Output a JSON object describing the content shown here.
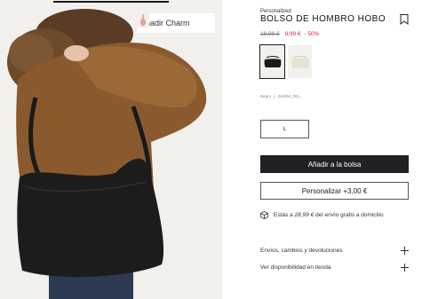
{
  "product": {
    "tag": "Personalized",
    "title": "BOLSO DE HOMBRO HOBO",
    "price_old": "19,99 €",
    "price_new": "9,99 €",
    "discount": "- 50%",
    "color_name": "Negro",
    "color_separator": "|",
    "reference": "344064_RN..."
  },
  "charm": {
    "label": "Añadir Charm",
    "icon": "charm-thumbnail"
  },
  "swatches": [
    {
      "name": "black",
      "selected": true,
      "color": "#1c1c1c"
    },
    {
      "name": "cream",
      "selected": false,
      "color": "#e7e1d6"
    }
  ],
  "size": {
    "selected": "L"
  },
  "actions": {
    "add_to_bag": "Añadir a la bolsa",
    "customize": "Personalizar +3,00 €"
  },
  "shipping": {
    "prefix": "Estás a",
    "amount": "28,99 €",
    "suffix": "del envío gratis a domicilio",
    "icon": "box-icon"
  },
  "accordions": [
    {
      "label": "Envíos, cambios y devoluciones"
    },
    {
      "label": "Ver disponibilidad en tienda"
    }
  ],
  "colors": {
    "primary_button": "#202124",
    "sale": "#e0203a",
    "bag": "#1c1c1c",
    "jacket": "#8a5a2e"
  }
}
